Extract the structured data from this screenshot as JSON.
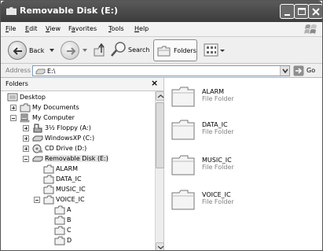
{
  "window": {
    "title": "Removable Disk (E:)"
  },
  "menu": {
    "items": [
      {
        "label": "File",
        "access": "F",
        "rest": "ile"
      },
      {
        "label": "Edit",
        "access": "E",
        "rest": "dit"
      },
      {
        "label": "View",
        "access": "V",
        "rest": "iew"
      },
      {
        "label": "Favorites",
        "access": "a",
        "pre": "F",
        "rest": "vorites"
      },
      {
        "label": "Tools",
        "access": "T",
        "rest": "ools"
      },
      {
        "label": "Help",
        "access": "H",
        "rest": "elp"
      }
    ]
  },
  "toolbar": {
    "back_label": "Back",
    "search_label": "Search",
    "folders_label": "Folders"
  },
  "address": {
    "label": "Address",
    "value": "E:\\",
    "go_label": "Go"
  },
  "folders_pane": {
    "title": "Folders",
    "close_glyph": "×",
    "tree": [
      {
        "label": "Desktop",
        "icon": "desktop-icon",
        "expander": "none"
      },
      {
        "label": "My Documents",
        "icon": "my-documents-icon",
        "expander": "plus"
      },
      {
        "label": "My Computer",
        "icon": "my-computer-icon",
        "expander": "minus"
      },
      {
        "label": "3½ Floppy (A:)",
        "icon": "floppy-drive-icon",
        "expander": "plus"
      },
      {
        "label": "WindowsXP (C:)",
        "icon": "hard-drive-icon",
        "expander": "plus"
      },
      {
        "label": "CD Drive (D:)",
        "icon": "cd-drive-icon",
        "expander": "plus"
      },
      {
        "label": "Removable Disk (E:)",
        "icon": "removable-disk-icon",
        "expander": "minus",
        "selected": true
      },
      {
        "label": "ALARM",
        "icon": "folder-icon",
        "expander": "none"
      },
      {
        "label": "DATA_IC",
        "icon": "folder-icon",
        "expander": "none"
      },
      {
        "label": "MUSIC_IC",
        "icon": "folder-icon",
        "expander": "none"
      },
      {
        "label": "VOICE_IC",
        "icon": "folder-icon",
        "expander": "minus"
      },
      {
        "label": "A",
        "icon": "folder-icon",
        "expander": "none"
      },
      {
        "label": "B",
        "icon": "folder-icon",
        "expander": "none"
      },
      {
        "label": "C",
        "icon": "folder-icon",
        "expander": "none"
      },
      {
        "label": "D",
        "icon": "folder-icon",
        "expander": "none"
      }
    ]
  },
  "content": {
    "items": [
      {
        "name": "ALARM",
        "type": "File Folder"
      },
      {
        "name": "DATA_IC",
        "type": "File Folder"
      },
      {
        "name": "MUSIC_IC",
        "type": "File Folder"
      },
      {
        "name": "VOICE_IC",
        "type": "File Folder"
      }
    ]
  }
}
